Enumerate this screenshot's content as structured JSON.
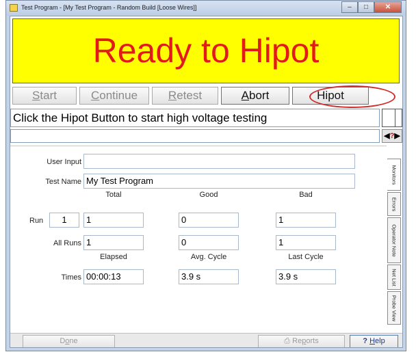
{
  "window": {
    "title": "Test Program - [My Test Program - Random Build [Loose Wires]]",
    "controls": {
      "minimize": "–",
      "maximize": "□",
      "close": "✕"
    }
  },
  "banner": {
    "text": "Ready to Hipot",
    "background": "#ffff00",
    "color": "#e31a1a"
  },
  "toolbar": {
    "start": {
      "pre": "",
      "key": "S",
      "post": "tart",
      "enabled": false
    },
    "continue": {
      "pre": "",
      "key": "C",
      "post": "ontinue",
      "enabled": false
    },
    "retest": {
      "pre": "",
      "key": "R",
      "post": "etest",
      "enabled": false
    },
    "abort": {
      "pre": "",
      "key": "A",
      "post": "bort",
      "enabled": true
    },
    "hipot": {
      "label": "Hipot",
      "enabled": true,
      "highlighted": true
    }
  },
  "message": {
    "line1": "Click the Hipot Button to start high voltage testing",
    "line2": ""
  },
  "nav": {
    "left": "◀",
    "mid": "?",
    "right": "▶"
  },
  "form": {
    "user_input": {
      "label": "User Input",
      "value": ""
    },
    "test_name": {
      "label": "Test Name",
      "value": "My Test Program"
    },
    "counts": {
      "headers": {
        "total": "Total",
        "good": "Good",
        "bad": "Bad"
      },
      "run": {
        "label": "Run",
        "number": "1",
        "total": "1",
        "good": "0",
        "bad": "1"
      },
      "all_runs": {
        "label": "All Runs",
        "total": "1",
        "good": "0",
        "bad": "1"
      }
    },
    "times": {
      "headers": {
        "elapsed": "Elapsed",
        "avg_cycle": "Avg. Cycle",
        "last_cycle": "Last Cycle"
      },
      "label": "Times",
      "elapsed": "00:00:13",
      "avg_cycle": "3.9 s",
      "last_cycle": "3.9 s"
    }
  },
  "side_tabs": [
    "Monitors",
    "Errors",
    "Operator Note",
    "Net List",
    "Probe View"
  ],
  "bottom": {
    "done": {
      "pre": "D",
      "key": "o",
      "post": "ne"
    },
    "reports": {
      "icon": "⎙",
      "pre": " Re",
      "key": "p",
      "post": "orts"
    },
    "help": {
      "icon": "?",
      "pre": " ",
      "key": "H",
      "post": "elp"
    }
  }
}
